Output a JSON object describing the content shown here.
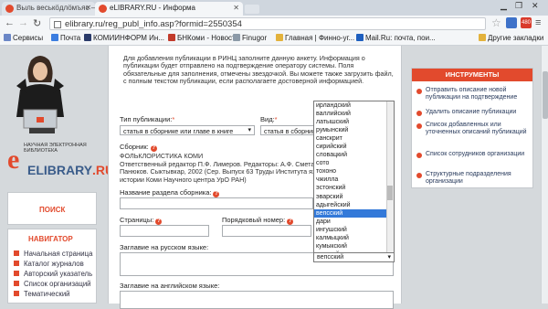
{
  "browser": {
    "tabs": [
      {
        "label": "Выль веськӧдлӧмъяс — W"
      },
      {
        "label": "eLIBRARY.RU - Информа"
      }
    ],
    "url": "elibrary.ru/reg_publ_info.asp?formid=2550354",
    "bookmarks": [
      {
        "label": "Сервисы"
      },
      {
        "label": "Почта"
      },
      {
        "label": "КОМИИНФОРМ Ин..."
      },
      {
        "label": "БНКоми - Новости"
      },
      {
        "label": "Finugor"
      },
      {
        "label": "Главная | Финно-уг..."
      },
      {
        "label": "Mail.Ru: почта, пои..."
      },
      {
        "label": "Другие закладки"
      }
    ],
    "badge": "480"
  },
  "logo": {
    "caption": "Научная электронная библиотека",
    "text_a": "ELIBRARY",
    "text_b": ".RU"
  },
  "left": {
    "search_label": "ПОИСК",
    "nav_title": "НАВИГАТОР",
    "nav_items": [
      {
        "label": "Начальная страница"
      },
      {
        "label": "Каталог журналов"
      },
      {
        "label": "Авторский указатель"
      },
      {
        "label": "Список организаций"
      },
      {
        "label": "Тематический"
      }
    ]
  },
  "form": {
    "intro": "Для добавления публикации в РИНЦ заполните данную анкету. Информация о публикации будет отправлено на подтверждение оператору системы. Поля обязательные для заполнения, отмечены звездочкой. Вы можете также загрузить файл, с полным текстом публикации, если располагаете достоверной информацией.",
    "type_label": "Тип публикации:",
    "type_value": "статья в сборнике или главе в книге",
    "kind_label": "Вид:",
    "kind_value": "статья в сборнике ст",
    "sbornik_label": "Сборник:",
    "sbornik_text": "ФОЛЬКЛОРИСТИКА КОМИ\nОтветственный редактор П.Ф. Лимеров. Редакторы: А.Ф. Сметанин, Г.С. Ющ..., А.В. Панюков. Сыктывкар, 2002 (Сер. Выпуск 63 Труды Института языка, литературы и истории Коми Научного центра УрО РАН)",
    "section_label": "Название раздела сборника:",
    "pages_label": "Страницы:",
    "order_label": "Порядковый номер:",
    "title_ru_label": "Заглавие на русском языке:",
    "title_en_label": "Заглавие на английском языке:"
  },
  "language_dropdown": {
    "options": [
      "ирландский",
      "валлийский",
      "латышский",
      "румынский",
      "санскрит",
      "сирийский",
      "словацкий",
      "сото",
      "тохоно",
      "чжилла",
      "эстонский",
      "эварский",
      "адыгейский",
      "вепсский",
      "дари",
      "ингушский",
      "калмыцкий",
      "кумыкский",
      "лакский",
      "македонский",
      "марийский",
      "мокшанский"
    ],
    "selected_index": 13,
    "current_value": "вепсский"
  },
  "tools": {
    "title": "ИНСТРУМЕНТЫ",
    "items": [
      {
        "label": "Отправить описание новой публикации на подтверждение"
      },
      {
        "label": "Удалить описание публикации"
      },
      {
        "label": "Список добавленных или уточненных описаний публикаций"
      },
      {
        "label": "Список сотрудников организации"
      },
      {
        "label": "Структурные подразделения организации"
      }
    ]
  }
}
